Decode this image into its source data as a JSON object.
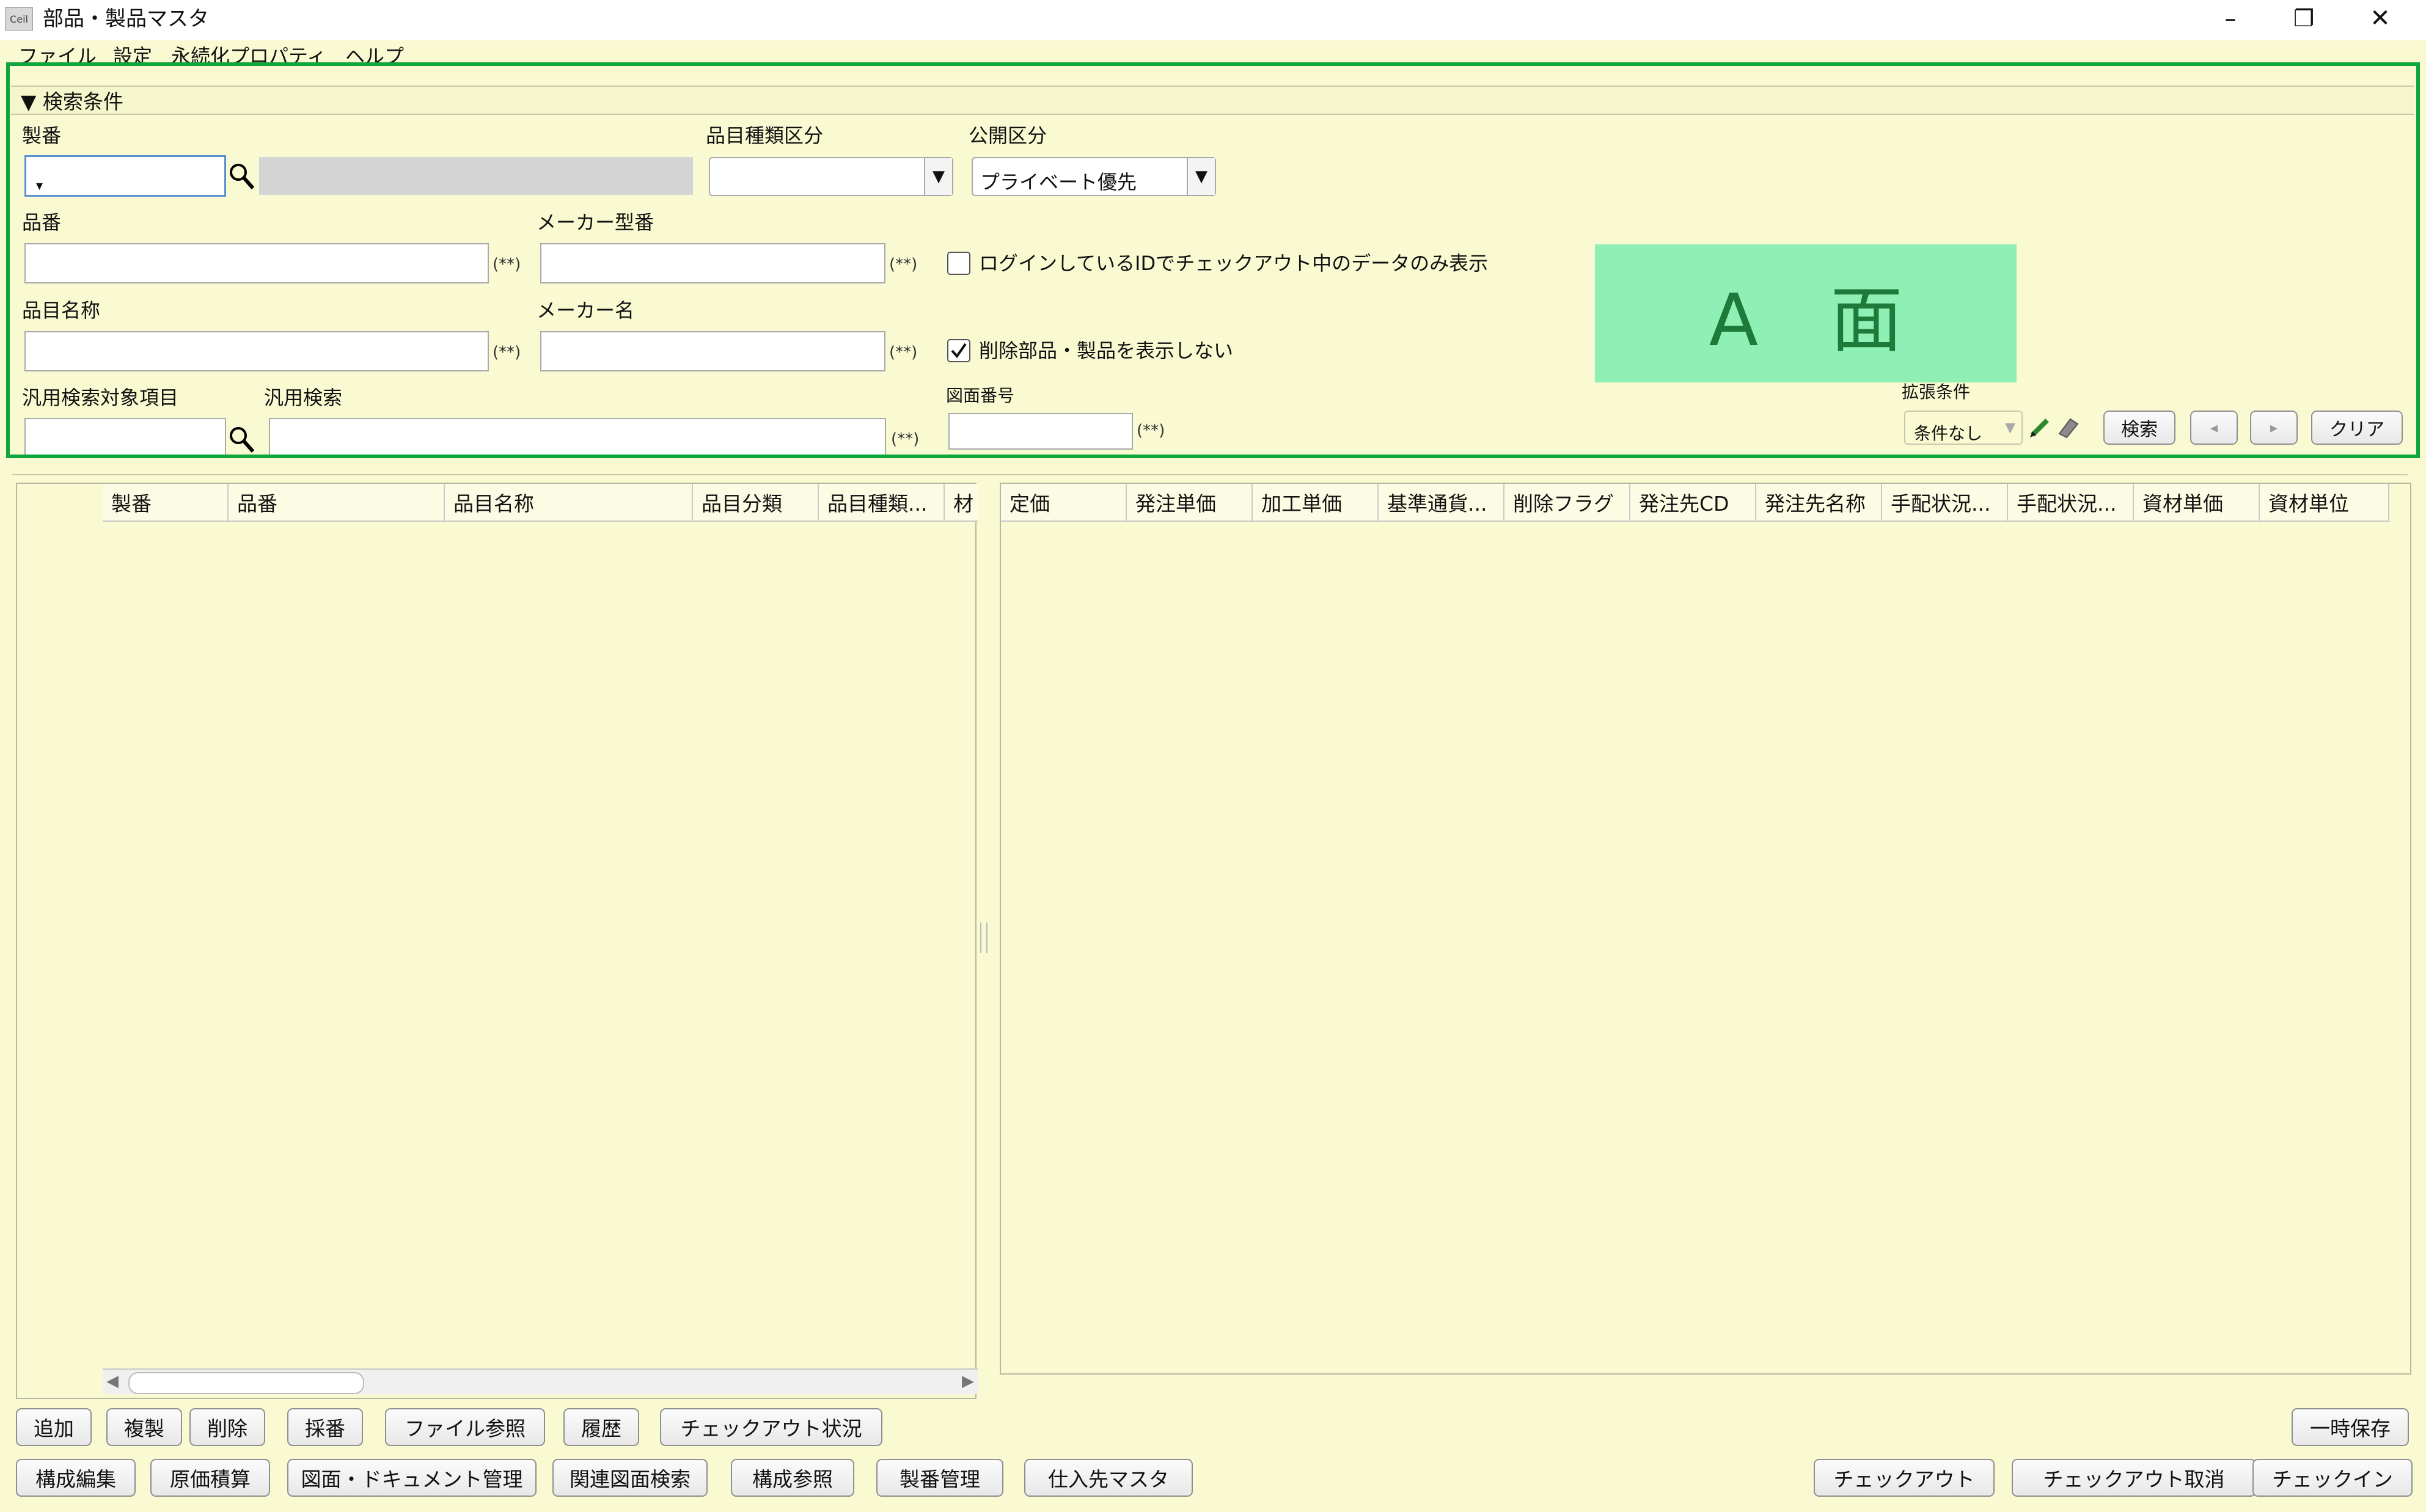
{
  "window": {
    "app_icon": "Ceil",
    "title": "部品・製品マスタ",
    "controls": {
      "minimize": "–",
      "restore": "❐",
      "close": "✕"
    }
  },
  "menu": {
    "items": [
      "ファイル",
      "設定",
      "永続化プロパティ",
      "ヘルプ"
    ]
  },
  "search_panel": {
    "header": "▼ 検索条件",
    "seiban": {
      "label": "製番",
      "value": ""
    },
    "hinmoku_shurui": {
      "label": "品目種類区分",
      "value": ""
    },
    "kokai": {
      "label": "公開区分",
      "value": "プライベート優先"
    },
    "hinban": {
      "label": "品番",
      "note": "(**)"
    },
    "maker_kataban": {
      "label": "メーカー型番",
      "note": "(**)"
    },
    "login_only": {
      "label": "ログインしているIDでチェックアウト中のデータのみ表示",
      "checked": false
    },
    "hinmoku_meisho": {
      "label": "品目名称",
      "note": "(**)"
    },
    "maker_mei": {
      "label": "メーカー名",
      "note": "(**)"
    },
    "hide_deleted": {
      "label": "削除部品・製品を表示しない",
      "checked": true
    },
    "hanyo_target": {
      "label": "汎用検索対象項目"
    },
    "hanyo_search": {
      "label": "汎用検索",
      "note": "(**)"
    },
    "zumen_bango": {
      "label": "図面番号",
      "note": "(**)"
    },
    "a_men": "A　面",
    "extension": {
      "label": "拡張条件",
      "value": "条件なし"
    },
    "buttons": {
      "search": "検索",
      "prev": "◂",
      "next": "▸",
      "clear": "クリア"
    }
  },
  "left_table": {
    "columns": [
      "製番",
      "品番",
      "品目名称",
      "品目分類",
      "品目種類...",
      "材"
    ]
  },
  "right_table": {
    "columns": [
      "定価",
      "発注単価",
      "加工単価",
      "基準通貨...",
      "削除フラグ",
      "発注先CD",
      "発注先名称",
      "手配状況...",
      "手配状況...",
      "資材単価",
      "資材単位"
    ]
  },
  "bottom_row1": [
    "追加",
    "複製",
    "削除",
    "採番",
    "ファイル参照",
    "履歴",
    "チェックアウト状況"
  ],
  "bottom_row1_right": "一時保存",
  "bottom_row2": [
    "構成編集",
    "原価積算",
    "図面・ドキュメント管理",
    "関連図面検索",
    "構成参照",
    "製番管理",
    "仕入先マスタ"
  ],
  "bottom_row2_right": [
    "チェックアウト",
    "チェックアウト取消",
    "チェックイン"
  ],
  "colors": {
    "panel_bg": "#fafad2",
    "highlight_border": "#0fa63c",
    "a_men_bg": "#8ef0b4",
    "a_men_text": "#1d7a3a"
  }
}
